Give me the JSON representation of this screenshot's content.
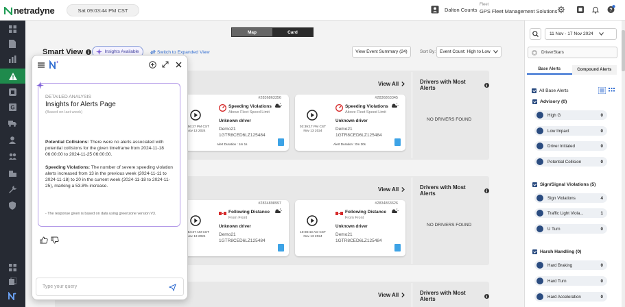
{
  "header": {
    "brand": "netradyne",
    "clock": "Sat 09:03:44 PM CST",
    "user_name": "Dalton Counts",
    "fleet_label": "Fleet",
    "fleet_name": "GPS Fleet Management Solutions"
  },
  "view_tabs": [
    "Map",
    "Card"
  ],
  "toolbar": {
    "title": "Smart View",
    "insights_button": "Insights Available",
    "expanded_link": "Switch to Expanded View",
    "summary_button": "View Event Summary (24)",
    "sort_label": "Sort By:",
    "sort_value": "Event Count: High to Low"
  },
  "sections": [
    {
      "view_all": "View All",
      "drivers_title": "Drivers with Most Alerts",
      "no_drivers": "NO DRIVERS FOUND",
      "cards": [
        {
          "time": "10:56:27 PM CST",
          "date": "Nov 13 2024"
        },
        {
          "id": "#2836863345",
          "title": "Speeding Violations",
          "subtitle": "Above Fleet Speed Limit",
          "driver": "Unknown driver",
          "device": "Demo21",
          "vin": "1GTR8CED6LZ125484",
          "time": "03:39:17 PM CST",
          "date": "Nov 13 2024",
          "duration": "Alert Duration : 0m 30s"
        }
      ],
      "partial_card": {
        "id": "#2836863356",
        "title": "Speeding Violations",
        "subtitle": "Above Fleet Speed Limit",
        "driver": "Unknown driver",
        "device": "Demo21",
        "vin": "1GTR8CED6LZ125484",
        "duration": "Alert Duration : 1m 1s"
      }
    },
    {
      "view_all": "View All",
      "drivers_title": "Drivers with Most Alerts",
      "no_drivers": "NO DRIVERS FOUND",
      "cards": [
        {
          "time": "10:54:37 AM CST",
          "date": "Nov 13 2024"
        },
        {
          "id": "#2834863626",
          "title": "Following Distance",
          "subtitle": "From Front",
          "driver": "Unknown driver",
          "device": "Demo21",
          "vin": "1GTR8CED6LZ125484",
          "time": "10:08:43 AM CST",
          "date": "Nov 13 2024"
        }
      ],
      "partial_card": {
        "id": "#2834898997",
        "title": "Following Distance",
        "subtitle": "From Front",
        "driver": "Unknown driver",
        "device": "Demo21",
        "vin": "1GTR8CED6LZ125484"
      }
    },
    {
      "view_all": "View All",
      "drivers_title": "Drivers with Most Alerts"
    }
  ],
  "filters": {
    "date_range": "11 Nov - 17 Nov 2024",
    "drivestars": "DriverStars",
    "tabs": [
      "Base Alerts",
      "Compound Alerts"
    ],
    "all_label": "All Base Alerts",
    "groups": [
      {
        "title": "Advisory (0)",
        "items": [
          {
            "label": "High G",
            "count": "0"
          },
          {
            "label": "Low Impact",
            "count": "0"
          },
          {
            "label": "Driver Initiated",
            "count": "0"
          },
          {
            "label": "Potential Collision",
            "count": "0"
          }
        ]
      },
      {
        "title": "Sign/Signal Violations (5)",
        "items": [
          {
            "label": "Sign Violations",
            "count": "4"
          },
          {
            "label": "Traffic Light Viola...",
            "count": "1"
          },
          {
            "label": "U Turn",
            "count": "0"
          }
        ]
      },
      {
        "title": "Harsh Handling (0)",
        "items": [
          {
            "label": "Hard Braking",
            "count": "0"
          },
          {
            "label": "Hard Turn",
            "count": "0"
          },
          {
            "label": "Hard Acceleration",
            "count": "0"
          }
        ]
      }
    ]
  },
  "assistant": {
    "heading_small": "DETAILED ANALYSIS",
    "heading": "Insights for Alerts Page",
    "subheading": "(Based on last week)",
    "p1_label": "Potential Collisions:",
    "p1_text": " There were no alerts associated with potential collisions for the given timeframe from 2024-11-18 06:00:00 to 2024-11-25 06:00:00.",
    "p2_label": "Speeding Violations:",
    "p2_text": " The number of severe speeding violation alerts increased from 13 in the previous week (2024-11-11 to 2024-11-18) to 20 in the current week (2024-11-18 to 2024-11-25), marking a 53.8% increase.",
    "footnote": "- The response given is based on data using greenzone version V3.",
    "query_placeholder": "Type your query"
  },
  "colors": {
    "accent": "#2f6bd0",
    "active_nav": "#1f8a4c",
    "sidebar": "#262a33",
    "alert_red": "#d62b2b"
  }
}
